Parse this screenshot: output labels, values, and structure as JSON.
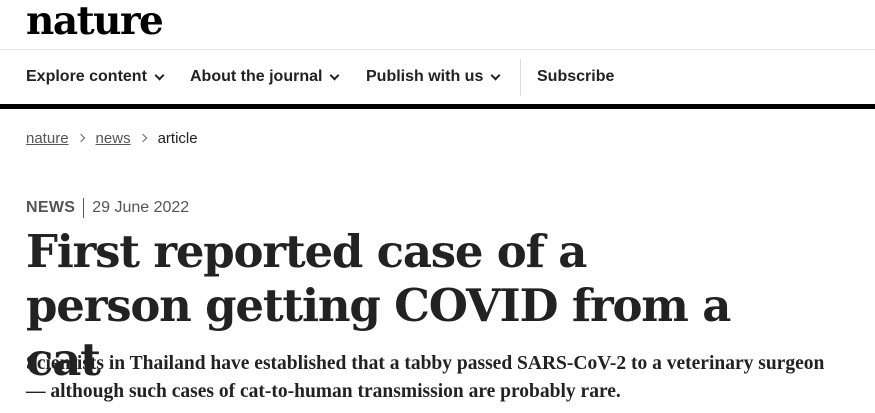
{
  "site": {
    "logo": "nature"
  },
  "nav": {
    "items": [
      {
        "label": "Explore content",
        "has_dropdown": true
      },
      {
        "label": "About the journal",
        "has_dropdown": true
      },
      {
        "label": "Publish with us",
        "has_dropdown": true
      },
      {
        "label": "Subscribe",
        "has_dropdown": false
      }
    ]
  },
  "breadcrumb": {
    "items": [
      {
        "label": "nature",
        "link": true
      },
      {
        "label": "news",
        "link": true
      },
      {
        "label": "article",
        "link": false
      }
    ]
  },
  "article": {
    "type": "NEWS",
    "date": "29 June 2022",
    "title": "First reported case of a person getting COVID from a cat",
    "standfirst": "Scientists in Thailand have established that a tabby passed SARS-CoV-2 to a veterinary surgeon — although such cases of cat-to-human transmission are probably rare."
  },
  "colors": {
    "text": "#222222",
    "muted": "#555555",
    "rule": "#000000"
  },
  "icons": {
    "dropdown": "chevron-down-icon",
    "breadcrumb_separator": "chevron-right-icon"
  }
}
